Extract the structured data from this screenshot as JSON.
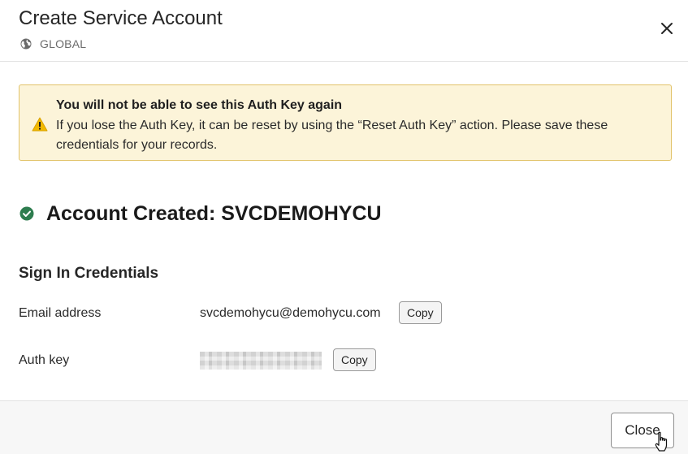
{
  "dialog": {
    "title": "Create Service Account",
    "scope": "GLOBAL",
    "scope_icon": "globe-icon",
    "close_icon": "close-icon"
  },
  "warning": {
    "icon": "warning-icon",
    "title": "You will not be able to see this Auth Key again",
    "body": "If you lose the Auth Key, it can be reset by using the “Reset Auth Key” action. Please save these credentials for your records.",
    "background": "#fcf4d9",
    "border": "#e2c36a"
  },
  "status": {
    "icon": "check-circle-icon",
    "text": "Account Created: SVCDEMOHYCU",
    "color": "#2e7d4f"
  },
  "credentials": {
    "heading": "Sign In Credentials",
    "email_label": "Email address",
    "email_value": "svcdemohycu@demohycu.com",
    "auth_label": "Auth key",
    "copy_label": "Copy"
  },
  "footer": {
    "close_label": "Close"
  }
}
